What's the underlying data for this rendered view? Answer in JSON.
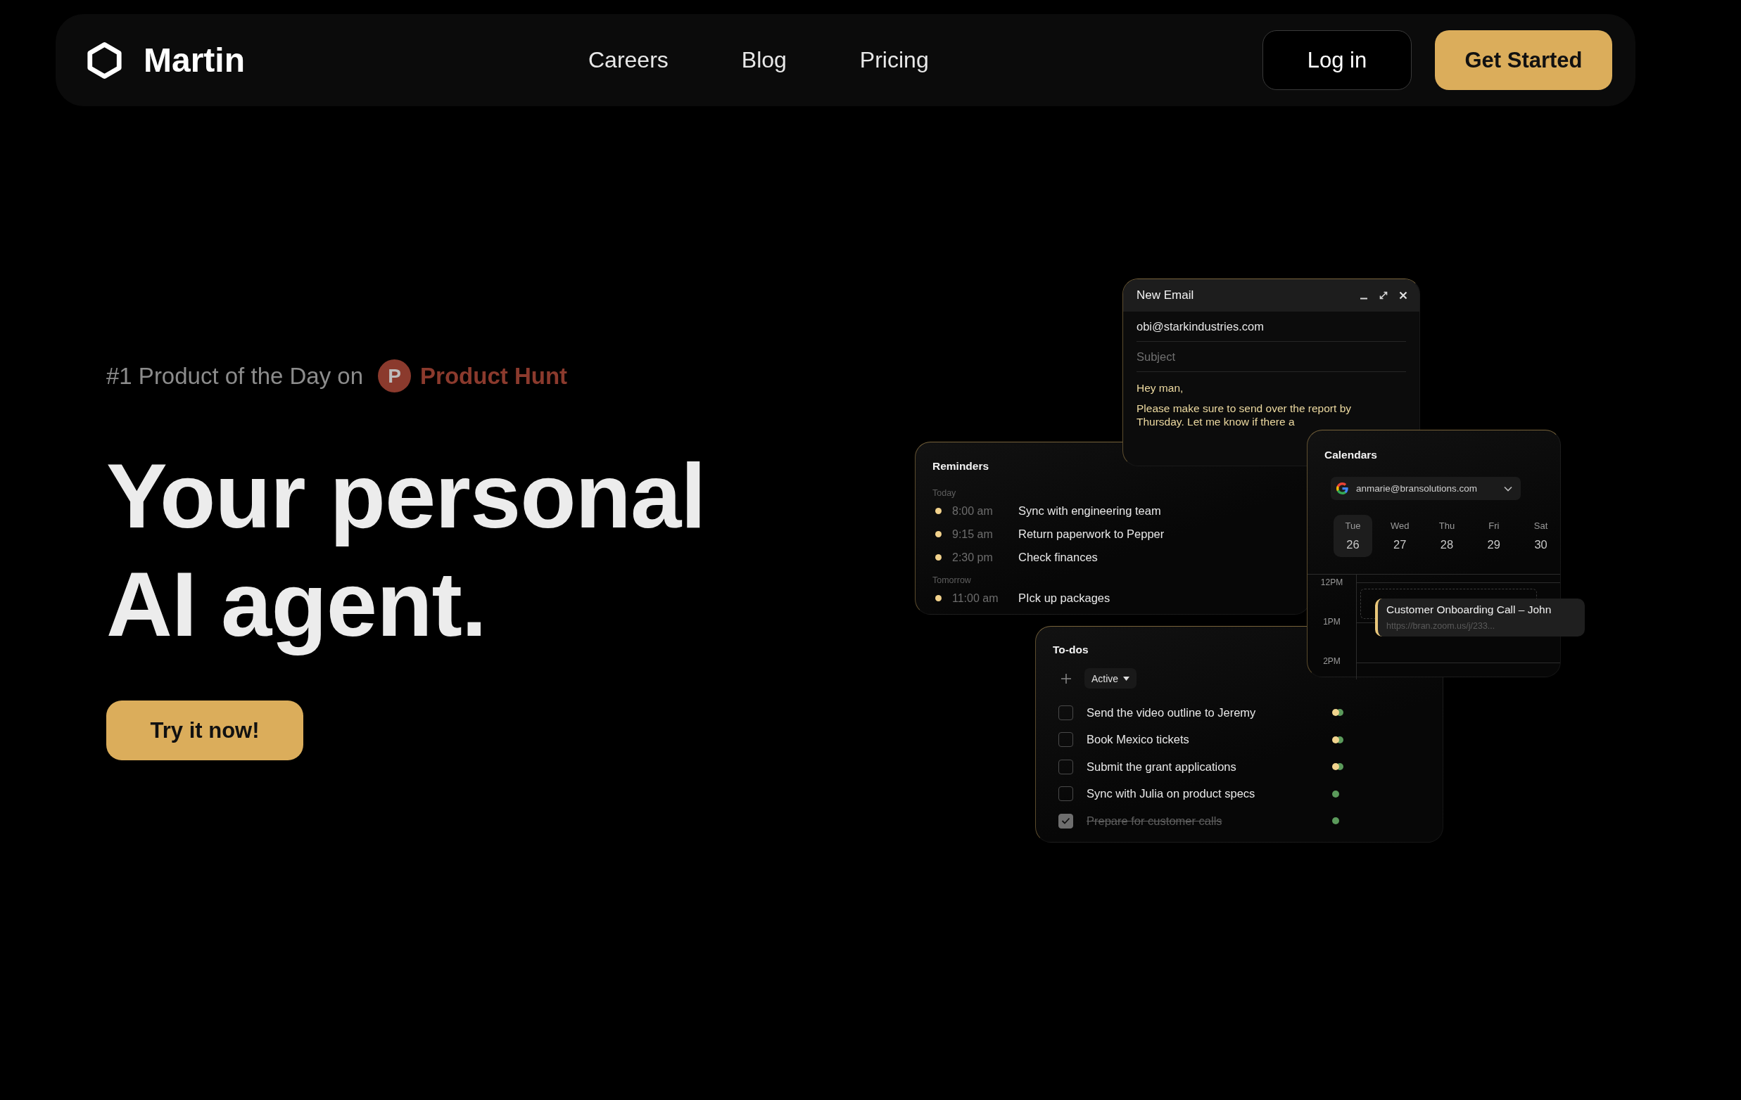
{
  "nav": {
    "brand": "Martin",
    "links": [
      "Careers",
      "Blog",
      "Pricing"
    ],
    "login": "Log in",
    "cta": "Get Started"
  },
  "hero": {
    "award": {
      "prefix": "#1 Product of the Day on",
      "logo_letter": "P",
      "name": "Product Hunt"
    },
    "headline": "Your personal AI agent.",
    "cta": "Try it now!"
  },
  "email": {
    "title": "New Email",
    "to": "obi@starkindustries.com",
    "subject": {
      "placeholder": "Subject"
    },
    "greeting": "Hey man,",
    "body": "Please make sure to send over the report by Thursday. Let me know if there a"
  },
  "reminders": {
    "title": "Reminders",
    "groups": [
      {
        "label": "Today",
        "items": [
          {
            "time": "8:00 am",
            "task": "Sync with engineering team"
          },
          {
            "time": "9:15 am",
            "task": "Return paperwork to Pepper"
          },
          {
            "time": "2:30 pm",
            "task": "Check finances"
          }
        ]
      },
      {
        "label": "Tomorrow",
        "items": [
          {
            "time": "11:00 am",
            "task": "PIck up packages"
          }
        ]
      }
    ]
  },
  "calendar": {
    "title": "Calendars",
    "account": "anmarie@bransolutions.com",
    "days": [
      {
        "name": "Tue",
        "date": "26",
        "selected": true
      },
      {
        "name": "Wed",
        "date": "27",
        "selected": false
      },
      {
        "name": "Thu",
        "date": "28",
        "selected": false
      },
      {
        "name": "Fri",
        "date": "29",
        "selected": false
      },
      {
        "name": "Sat",
        "date": "30",
        "selected": false
      }
    ],
    "hours": [
      "12PM",
      "1PM",
      "2PM"
    ],
    "event": {
      "title": "Customer Onboarding Call – John",
      "link": "https://bran.zoom.us/j/233..."
    }
  },
  "todos": {
    "title": "To-dos",
    "filter": "Active",
    "items": [
      {
        "text": "Send the video outline to Jeremy",
        "checked": false,
        "markers": [
          {
            "color": "#f1d48e"
          },
          {
            "color": "#5b9a5b"
          }
        ]
      },
      {
        "text": "Book Mexico tickets",
        "checked": false,
        "markers": [
          {
            "color": "#f1d48e"
          },
          {
            "color": "#5b9a5b"
          }
        ]
      },
      {
        "text": "Submit the grant applications",
        "checked": false,
        "markers": [
          {
            "color": "#f1d48e"
          },
          {
            "color": "#5b9a5b"
          }
        ]
      },
      {
        "text": "Sync with Julia on product specs",
        "checked": false,
        "markers": [
          {
            "color": "#5b9a5b"
          }
        ]
      },
      {
        "text": "Prepare for customer calls",
        "checked": true,
        "markers": [
          {
            "color": "#5b9a5b"
          }
        ]
      }
    ]
  }
}
